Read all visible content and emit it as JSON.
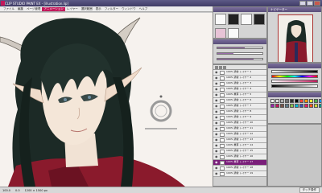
{
  "window": {
    "title": "CLIP STUDIO PAINT EX - [illustration.lip]"
  },
  "menu": {
    "items": [
      {
        "label": "ファイル"
      },
      {
        "label": "編集"
      },
      {
        "label": "ページ管理"
      },
      {
        "label": "アニメーション"
      },
      {
        "label": "レイヤー"
      },
      {
        "label": "選択範囲"
      },
      {
        "label": "表示"
      },
      {
        "label": "フィルター"
      },
      {
        "label": "ウィンドウ"
      },
      {
        "label": "ヘルプ"
      }
    ],
    "active_index": 3
  },
  "panels": {
    "navigator_title": "ナビゲーター",
    "layer_toolbar": [
      "new-layer-icon",
      "folder-icon",
      "delete-icon"
    ]
  },
  "layers": [
    {
      "name": "レイヤー 1",
      "mode": "100% 通常",
      "selected": false
    },
    {
      "name": "レイヤー 2",
      "mode": "100% 通常",
      "selected": false
    },
    {
      "name": "レイヤー 3",
      "mode": "100% 通常",
      "selected": false
    },
    {
      "name": "レイヤー 4",
      "mode": "100% 通常",
      "selected": false
    },
    {
      "name": "レイヤー 5",
      "mode": "100% 乗算",
      "selected": false
    },
    {
      "name": "レイヤー 6",
      "mode": "100% 通常",
      "selected": false
    },
    {
      "name": "レイヤー 7",
      "mode": "100% 通常",
      "selected": false
    },
    {
      "name": "レイヤー 8",
      "mode": "100% 通常",
      "selected": false
    },
    {
      "name": "レイヤー 9",
      "mode": "100% 通常",
      "selected": false
    },
    {
      "name": "レイヤー 10",
      "mode": "100% 通常",
      "selected": false
    },
    {
      "name": "レイヤー 11",
      "mode": "100% 通常",
      "selected": false
    },
    {
      "name": "レイヤー 12",
      "mode": "100% 通常",
      "selected": false
    },
    {
      "name": "レイヤー 13",
      "mode": "100% 通常",
      "selected": false
    },
    {
      "name": "レイヤー 14",
      "mode": "100% 乗算",
      "selected": false
    },
    {
      "name": "レイヤー 15",
      "mode": "100% 通常",
      "selected": false
    },
    {
      "name": "レイヤー 16",
      "mode": "100% 通常",
      "selected": false
    },
    {
      "name": "レイヤー 17",
      "mode": "100% 乗算",
      "selected": true
    },
    {
      "name": "レイヤー 18",
      "mode": "100% 通常",
      "selected": false
    },
    {
      "name": "レイヤー 19",
      "mode": "100% 通常",
      "selected": false
    }
  ],
  "palette": [
    "#ffffff",
    "#e0e0e0",
    "#b0b0b0",
    "#707070",
    "#303030",
    "#000000",
    "#f44336",
    "#ff9800",
    "#ffeb3b",
    "#4caf50",
    "#2196f3",
    "#9c27b0",
    "#c2185b",
    "#795548",
    "#607d8b",
    "#8bc34a",
    "#00bcd4",
    "#3f51b5",
    "#e91e63",
    "#ff5722",
    "#cddc39",
    "#009688"
  ],
  "tool_sliders": [
    0.6,
    0.35,
    0.8
  ],
  "statusbar": {
    "zoom": "100.0",
    "angle": "0.0",
    "size": "1200 × 1500 px",
    "button": "タッチ操作"
  },
  "colors": {
    "accent": "#c2185b",
    "selection": "#7a1f7a",
    "hair": "#1c2a26",
    "robe": "#8a1a2c"
  }
}
